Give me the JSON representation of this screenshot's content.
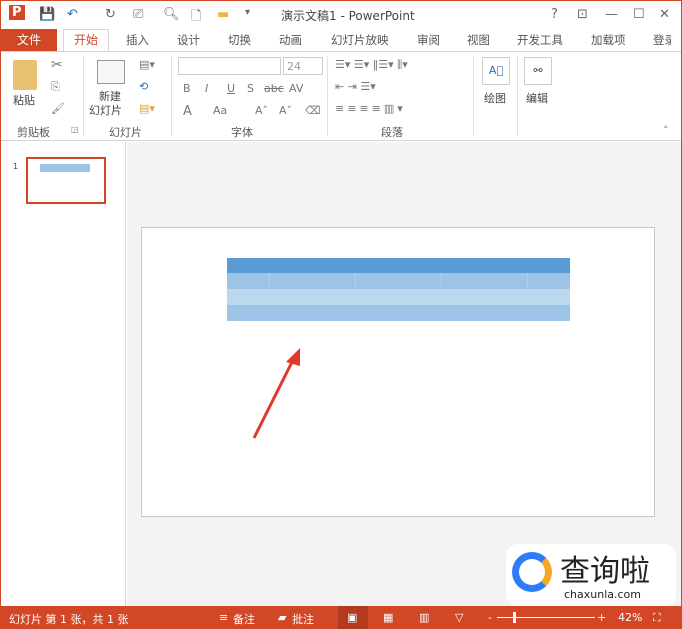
{
  "window": {
    "title": "演示文稿1 - PowerPoint",
    "help": "?",
    "restore_ribbon": "⊡",
    "minimize": "—",
    "maximize": "☐",
    "close": "✕"
  },
  "qat": {
    "app_icon": "P",
    "save": "💾",
    "undo": "↶",
    "redo": "↻",
    "more": "⚲",
    "dropdown": "▾"
  },
  "tabs": {
    "file": "文件",
    "items": [
      "开始",
      "插入",
      "设计",
      "切换",
      "动画",
      "幻灯片放映",
      "审阅",
      "视图",
      "开发工具",
      "加载项",
      "登录"
    ]
  },
  "ribbon": {
    "clipboard": {
      "paste": "粘贴",
      "label": "剪贴板"
    },
    "slides": {
      "new_slide_line1": "新建",
      "new_slide_line2": "幻灯片",
      "label": "幻灯片"
    },
    "font": {
      "font_size": "24",
      "bold": "B",
      "italic": "I",
      "underline": "U",
      "shadow": "S",
      "strike": "abc",
      "spacing": "AV",
      "color": "A",
      "case": "Aa",
      "grow": "A˄",
      "shrink": "A˅",
      "label": "字体"
    },
    "paragraph": {
      "label": "段落"
    },
    "drawing": {
      "label": "绘图"
    },
    "editing": {
      "label": "编辑"
    }
  },
  "thumbnail": {
    "number": "1"
  },
  "watermark": {
    "text": "查询啦",
    "url": "chaxunla.com"
  },
  "status": {
    "slide_info": "幻灯片 第 1 张，共 1 张",
    "notes": "备注",
    "comments": "批注",
    "zoom": "42%",
    "zoom_minus": "-",
    "zoom_plus": "+"
  },
  "colors": {
    "accent": "#D24726",
    "table_header": "#5B9BD5",
    "table_row1": "#9DC3E6",
    "table_row2": "#BDD7EE",
    "arrow": "#E0392B"
  }
}
